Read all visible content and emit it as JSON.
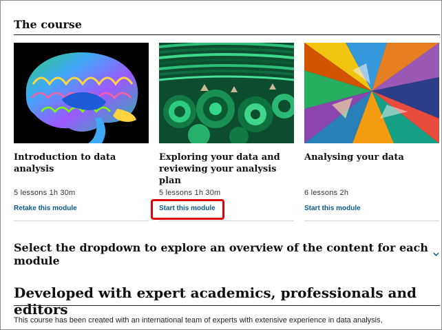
{
  "course_section": {
    "title": "The course"
  },
  "modules": [
    {
      "title": "Introduction to data analysis",
      "meta": "5 lessons 1h 30m",
      "link_label": "Retake this module",
      "image": "brain-mri-image"
    },
    {
      "title": "Exploring your data and reviewing your analysis plan",
      "meta": "5 lessons 1h 30m",
      "link_label": "Start this module",
      "image": "malachite-mineral-image"
    },
    {
      "title": "Analysing your data",
      "meta": "6 lessons 2h",
      "link_label": "Start this module",
      "image": "crystal-micrograph-image"
    }
  ],
  "dropdown": {
    "label": "Select the dropdown to explore an overview of the content for each module",
    "icon": "chevron-down-icon"
  },
  "developed": {
    "title": "Developed with expert academics, professionals and editors",
    "body": "This course has been created with an international team of experts with extensive experience in data analysis,"
  },
  "colors": {
    "link": "#0a5a8a",
    "highlight": "#e00000"
  }
}
